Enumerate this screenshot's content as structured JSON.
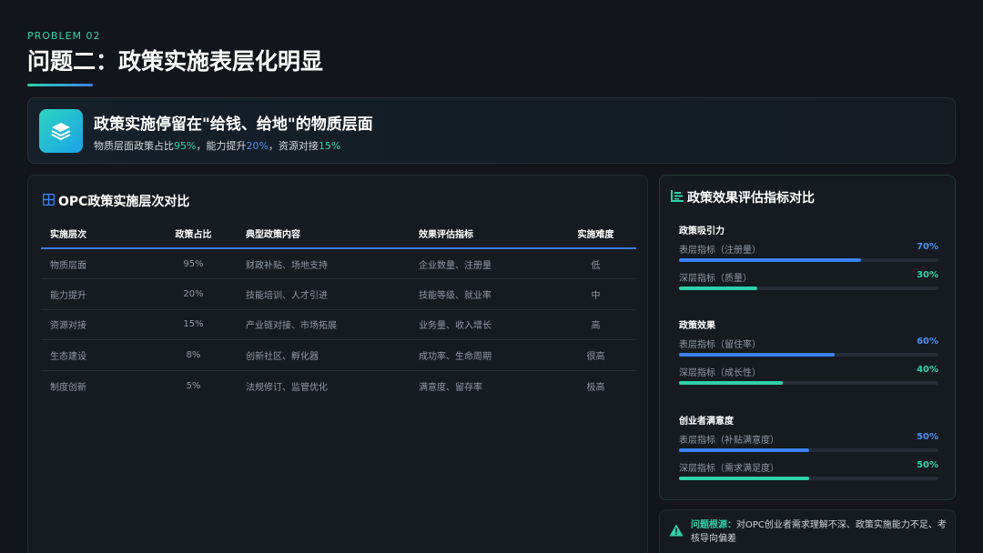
{
  "header": {
    "eyebrow": "PROBLEM 02",
    "title": "问题二：政策实施表层化明显"
  },
  "banner": {
    "title": "政策实施停留在\"给钱、给地\"的物质层面",
    "sub_prefix": "物质层面政策占比",
    "sub_v1": "95%",
    "sub_mid1": "，能力提升",
    "sub_v2": "20%",
    "sub_mid2": "，资源对接",
    "sub_v3": "15%",
    "icon": "layers-icon"
  },
  "table": {
    "title": "OPC政策实施层次对比",
    "icon": "table-icon",
    "headers": [
      "实施层次",
      "政策占比",
      "典型政策内容",
      "效果评估指标",
      "实施难度"
    ],
    "rows": [
      [
        "物质层面",
        "95%",
        "财政补贴、场地支持",
        "企业数量、注册量",
        "低"
      ],
      [
        "能力提升",
        "20%",
        "技能培训、人才引进",
        "技能等级、就业率",
        "中"
      ],
      [
        "资源对接",
        "15%",
        "产业链对接、市场拓展",
        "业务量、收入增长",
        "高"
      ],
      [
        "生态建设",
        "8%",
        "创新社区、孵化器",
        "成功率、生命周期",
        "很高"
      ],
      [
        "制度创新",
        "5%",
        "法规修订、监管优化",
        "满意度、留存率",
        "极高"
      ]
    ]
  },
  "metrics": {
    "title": "政策效果评估指标对比",
    "icon": "chart-bars-icon",
    "groups": [
      {
        "title": "政策吸引力",
        "items": [
          {
            "label": "表层指标（注册量）",
            "value": "70%"
          },
          {
            "label": "深层指标（质量）",
            "value": "30%"
          }
        ]
      },
      {
        "title": "政策效果",
        "items": [
          {
            "label": "表层指标（留住率）",
            "value": "60%"
          },
          {
            "label": "深层指标（成长性）",
            "value": "40%"
          }
        ]
      },
      {
        "title": "创业者满意度",
        "items": [
          {
            "label": "表层指标（补贴满意度）",
            "value": "50%"
          },
          {
            "label": "深层指标（需求满足度）",
            "value": "50%"
          }
        ]
      }
    ]
  },
  "note": {
    "key": "问题根源：",
    "text": "对OPC创业者需求理解不深、政策实施能力不足、考核导向偏差",
    "icon": "warning-icon"
  },
  "colors": {
    "accent_green": "#2ed1a8",
    "accent_blue": "#3b82f6"
  },
  "chart_data": {
    "type": "bar",
    "orientation": "horizontal",
    "title": "政策效果评估指标对比",
    "categories": [
      "政策吸引力",
      "政策效果",
      "创业者满意度"
    ],
    "series": [
      {
        "name": "表层指标",
        "labels": [
          "表层指标（注册量）",
          "表层指标（留住率）",
          "表层指标（补贴满意度）"
        ],
        "values": [
          70,
          60,
          50
        ],
        "color": "#3b82f6"
      },
      {
        "name": "深层指标",
        "labels": [
          "深层指标（质量）",
          "深层指标（成长性）",
          "深层指标（需求满足度）"
        ],
        "values": [
          30,
          40,
          50
        ],
        "color": "#2ed1a8"
      }
    ],
    "xlim": [
      0,
      100
    ]
  }
}
